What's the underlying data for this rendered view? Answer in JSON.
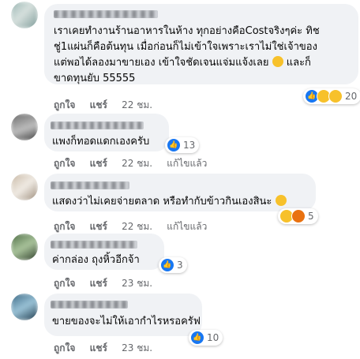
{
  "comments": [
    {
      "lines": [
        "เราเคยทำงานร้านอาหารในห้าง  ทุกอย่างคือCostจริงๆค่ะ  ทิช",
        "ชู่1แผ่นก็คือต้นทุน  เมื่อก่อนก็ไม่เข้าใจเพราะเราไม่ใช่เจ้าของ",
        "แต่พอได้ลองมาขายเอง  เข้าใจชัดเจนแจ่มแจ้งเลย",
        "ขาดทุนยับ 55555"
      ],
      "line3_suffix": "และก็",
      "reaction_count": "20",
      "like": "ถูกใจ",
      "reply": "แชร์",
      "time": "22 ชม.",
      "edited": ""
    },
    {
      "lines": [
        "แพงก็ทอดแดกเองครับ"
      ],
      "reaction_count": "13",
      "like": "ถูกใจ",
      "reply": "แชร์",
      "time": "22 ชม.",
      "edited": "แก้ไขแล้ว"
    },
    {
      "lines": [
        "แสดงว่าไม่เคยจ่ายตลาด  หรือทำกับข้าวกินเองสินะ"
      ],
      "reaction_count": "5",
      "like": "ถูกใจ",
      "reply": "แชร์",
      "time": "22 ชม.",
      "edited": "แก้ไขแล้ว"
    },
    {
      "lines": [
        "ค่ากล่อง  ถุงหิ้วอีกจ้า"
      ],
      "reaction_count": "3",
      "like": "ถูกใจ",
      "reply": "แชร์",
      "time": "23 ชม.",
      "edited": ""
    },
    {
      "lines": [
        "ขายของจะไม่ให้เอากำไรหรอครัฟ"
      ],
      "reaction_count": "10",
      "like": "ถูกใจ",
      "reply": "แชร์",
      "time": "23 ชม.",
      "edited": ""
    }
  ],
  "icons": {
    "like": "thumbs-up-icon",
    "haha": "laughing-emoji-icon",
    "sad": "sad-emoji-icon",
    "angry": "angry-emoji-icon",
    "wink": "smirk-emoji-icon"
  },
  "colors": {
    "bubble": "#f0f2f5",
    "meta_text": "#65676b",
    "like_blue": "#1877f2"
  }
}
